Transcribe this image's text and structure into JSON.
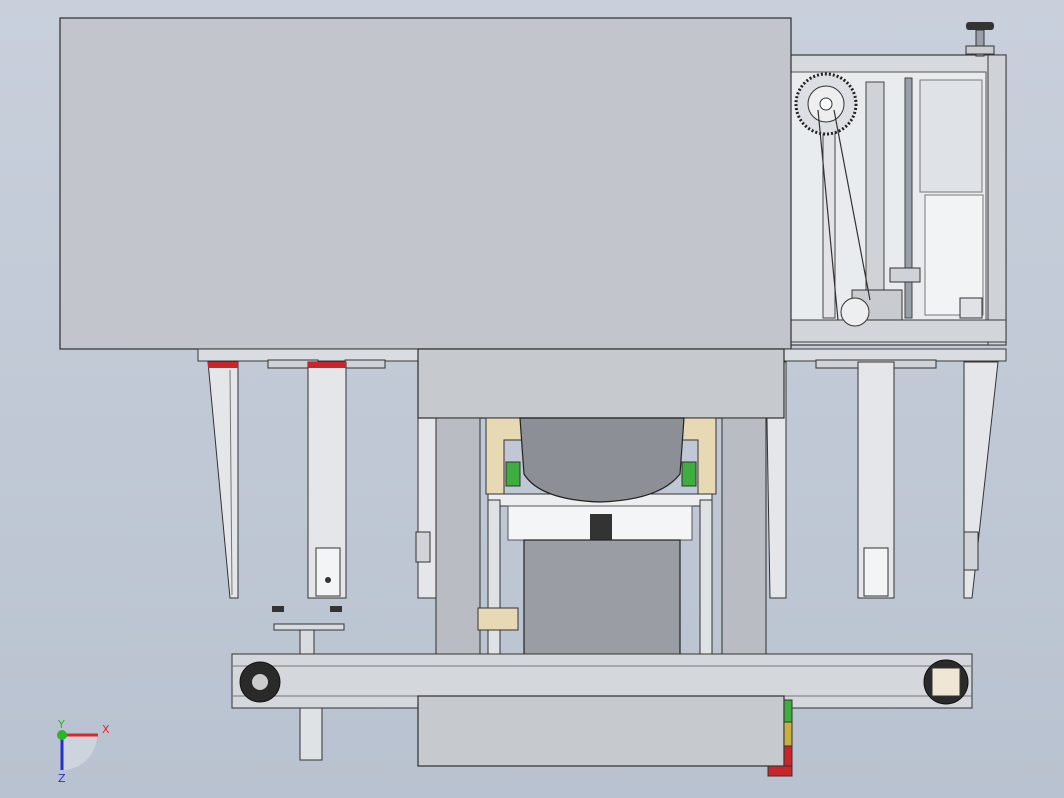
{
  "viewport": {
    "background_top": "#c9d0dc",
    "background_bottom": "#b9c2d0"
  },
  "triad": {
    "x_label": "X",
    "y_label": "Y",
    "z_label": "Z",
    "x_color": "#e0262a",
    "y_color": "#2bb52b",
    "z_color": "#2233cc"
  },
  "colors": {
    "panel": "#c2c6cc",
    "outline": "#3a3a3a",
    "steel": "#d8dbe0",
    "red_accent": "#c8262a",
    "green_accent": "#3fae3f",
    "tan_bracket": "#e8d9b5",
    "dark_drum": "#8c9096"
  }
}
